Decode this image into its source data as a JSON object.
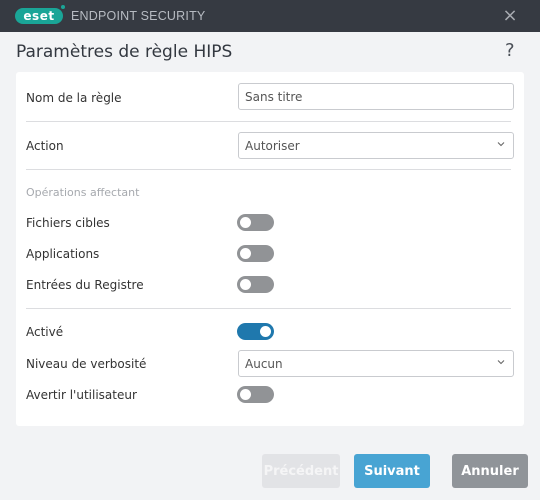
{
  "window": {
    "logo_text": "eset",
    "app_title": "ENDPOINT SECURITY",
    "close_icon": "×"
  },
  "header": {
    "title": "Paramètres de règle HIPS",
    "help_icon": "?"
  },
  "form": {
    "rule_name": {
      "label": "Nom de la règle",
      "value": "Sans titre"
    },
    "action": {
      "label": "Action",
      "value": "Autoriser"
    },
    "section_label": "Opérations affectant",
    "toggles": [
      {
        "label": "Fichiers cibles",
        "on": false
      },
      {
        "label": "Applications",
        "on": false
      },
      {
        "label": "Entrées du Registre",
        "on": false
      }
    ],
    "enabled": {
      "label": "Activé",
      "on": true
    },
    "verbosity": {
      "label": "Niveau de verbosité",
      "value": "Aucun"
    },
    "notify_user": {
      "label": "Avertir l'utilisateur",
      "on": false
    }
  },
  "buttons": {
    "previous": "Précédent",
    "next": "Suivant",
    "cancel": "Annuler"
  },
  "colors": {
    "titlebar": "#363a42",
    "brand": "#1aa597",
    "toggle_on": "#1f78ad",
    "toggle_off": "#919396",
    "primary_button": "#48a4d3",
    "cancel_button": "#909499"
  }
}
